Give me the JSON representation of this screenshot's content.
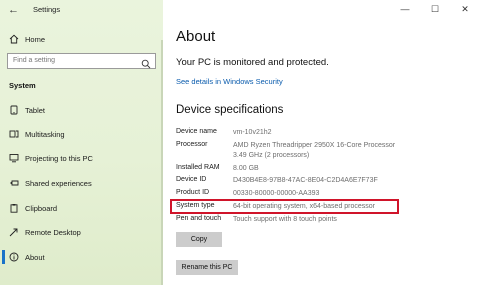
{
  "window": {
    "title": "Settings",
    "controls": {
      "minimize": "—",
      "maximize": "☐",
      "close": "✕"
    }
  },
  "sidebar": {
    "back_icon": "back-arrow-icon",
    "home_label": "Home",
    "search": {
      "placeholder": "Find a setting"
    },
    "section_label": "System",
    "items": [
      {
        "label": "Tablet",
        "icon": "tablet-icon"
      },
      {
        "label": "Multitasking",
        "icon": "multitasking-icon"
      },
      {
        "label": "Projecting to this PC",
        "icon": "projecting-icon"
      },
      {
        "label": "Shared experiences",
        "icon": "shared-experiences-icon"
      },
      {
        "label": "Clipboard",
        "icon": "clipboard-icon"
      },
      {
        "label": "Remote Desktop",
        "icon": "remote-desktop-icon"
      },
      {
        "label": "About",
        "icon": "info-icon",
        "selected": true
      }
    ]
  },
  "main": {
    "title": "About",
    "protection_text": "Your PC is monitored and protected.",
    "security_link": "See details in Windows Security",
    "specs_heading": "Device specifications",
    "specs": [
      {
        "label": "Device name",
        "value": "vm-10v21h2"
      },
      {
        "label": "Processor",
        "value": "AMD Ryzen Threadripper 2950X 16-Core Processor",
        "value2": "3.49 GHz  (2 processors)"
      },
      {
        "label": "Installed RAM",
        "value": "8.00 GB"
      },
      {
        "label": "Device ID",
        "value": "D430B4E8-97B8-47AC-8E04-C2D4A6E7F73F"
      },
      {
        "label": "Product ID",
        "value": "00330-80000-00000-AA393"
      },
      {
        "label": "System type",
        "value": "64-bit operating system, x64-based processor"
      },
      {
        "label": "Pen and touch",
        "value": "Touch support with 8 touch points"
      }
    ],
    "copy_button": "Copy",
    "rename_button": "Rename this PC"
  },
  "colors": {
    "accent": "#1a73c8",
    "highlight": "#d0142a",
    "link": "#0b5cad",
    "sidebar_bg": "#e6f1d6"
  }
}
